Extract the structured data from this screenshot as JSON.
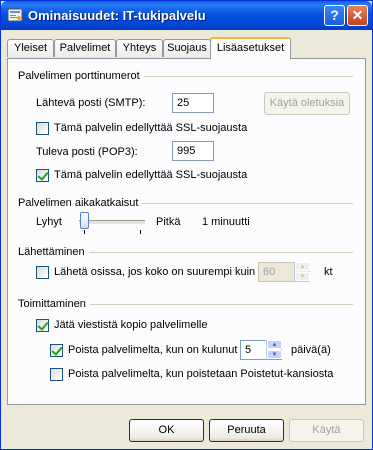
{
  "window": {
    "title": "Ominaisuudet: IT-tukipalvelu",
    "help_label": "?",
    "close_label": "✕"
  },
  "tabs": [
    {
      "label": "Yleiset"
    },
    {
      "label": "Palvelimet"
    },
    {
      "label": "Yhteys"
    },
    {
      "label": "Suojaus"
    },
    {
      "label": "Lisäasetukset",
      "active": true
    }
  ],
  "ports": {
    "group_label": "Palvelimen porttinumerot",
    "smtp_label": "Lähtevä posti (SMTP):",
    "smtp_value": "25",
    "defaults_button": "Käytä oletuksia",
    "smtp_ssl_label": "Tämä palvelin edellyttää SSL-suojausta",
    "smtp_ssl_checked": false,
    "pop3_label": "Tuleva posti (POP3):",
    "pop3_value": "995",
    "pop3_ssl_label": "Tämä palvelin edellyttää SSL-suojausta",
    "pop3_ssl_checked": true
  },
  "timeouts": {
    "group_label": "Palvelimen aikakatkaisut",
    "short_label": "Lyhyt",
    "long_label": "Pitkä",
    "value_text": "1 minuutti",
    "slider_fraction": 0.0
  },
  "sending": {
    "group_label": "Lähettäminen",
    "split_label": "Lähetä osissa, jos koko on suurempi kuin",
    "split_checked": false,
    "split_value": "60",
    "unit": "kt"
  },
  "delivery": {
    "group_label": "Toimittaminen",
    "keep_copy_label": "Jätä viestistä kopio palvelimelle",
    "keep_copy_checked": true,
    "remove_after_label": "Poista palvelimelta, kun on kulunut",
    "remove_after_checked": true,
    "remove_after_value": "5",
    "days_unit": "päivä(ä)",
    "remove_deleted_label": "Poista palvelimelta, kun poistetaan Poistetut-kansiosta",
    "remove_deleted_checked": false
  },
  "footer": {
    "ok": "OK",
    "cancel": "Peruuta",
    "apply": "Käytä"
  }
}
